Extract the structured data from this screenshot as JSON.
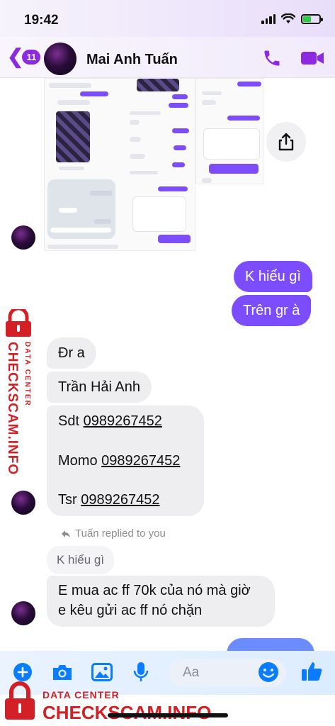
{
  "status": {
    "time": "19:42"
  },
  "header": {
    "back_count": "11",
    "contact_name": "Mai Anh Tuấn"
  },
  "messages": {
    "out1": "K hiểu gì",
    "out2": "Trên gr à",
    "in1": "Đr a",
    "in2": "Trần Hải Anh",
    "in3_sdt_label": "Sdt",
    "in3_sdt_value": "0989267452",
    "in3_momo_label": "Momo",
    "in3_momo_value": "0989267452",
    "in3_tsr_label": "Tsr",
    "in3_tsr_value": "0989267452",
    "replied_note": "Tuấn replied to you",
    "quoted": "K hiểu gì",
    "in4_line1": "E mua ac ff 70k của nó mà giờ",
    "in4_line2": "e kêu gửi ac ff nó chặn"
  },
  "composer": {
    "placeholder": "Aa"
  },
  "watermark": {
    "line1": "DATA CENTER",
    "line2": "CHECKSCAM.INFO"
  },
  "colors": {
    "accent": "#7b4dff",
    "brand_purple": "#8a2be2",
    "watermark_red": "#d32027"
  }
}
